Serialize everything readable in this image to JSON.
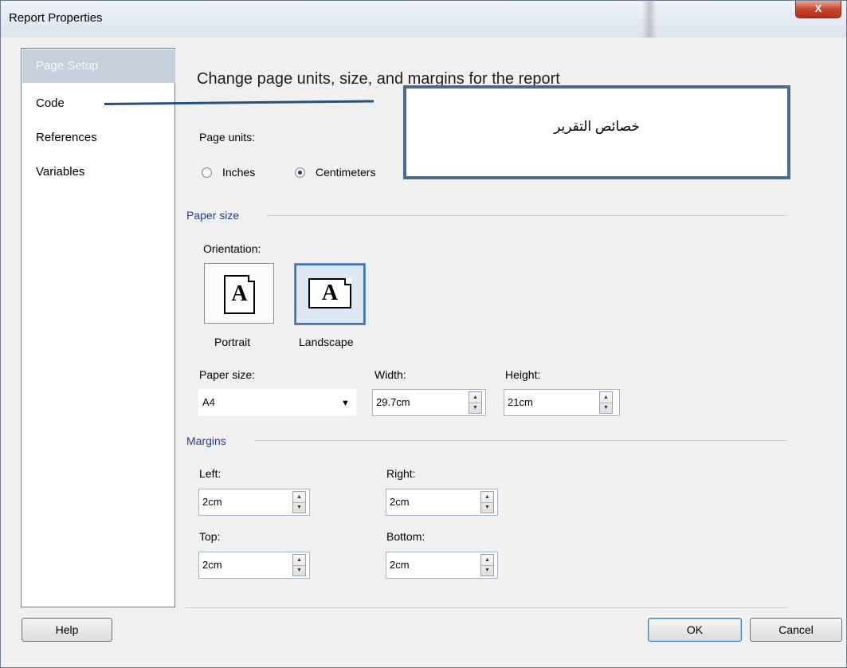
{
  "window": {
    "title": "Report Properties",
    "close_glyph": "X"
  },
  "nav": {
    "items": [
      {
        "label": "Page Setup",
        "active": true
      },
      {
        "label": "Code"
      },
      {
        "label": "References"
      },
      {
        "label": "Variables"
      }
    ]
  },
  "content": {
    "title": "Change page units, size, and margins for the report",
    "page_units_label": "Page units:",
    "units": {
      "inches": "Inches",
      "centimeters": "Centimeters",
      "selected": "Centimeters"
    },
    "paper_section": "Paper size",
    "orientation_label": "Orientation:",
    "orientation": {
      "portrait": "Portrait",
      "landscape": "Landscape",
      "selected": "Landscape",
      "icon_letter": "A"
    },
    "paper_size_label": "Paper size:",
    "paper_size_value": "A4",
    "width_label": "Width:",
    "width_value": "29.7cm",
    "height_label": "Height:",
    "height_value": "21cm",
    "margins_section": "Margins",
    "margins": {
      "left_label": "Left:",
      "left_value": "2cm",
      "right_label": "Right:",
      "right_value": "2cm",
      "top_label": "Top:",
      "top_value": "2cm",
      "bottom_label": "Bottom:",
      "bottom_value": "2cm"
    }
  },
  "annotation": {
    "text": "خصائص التقرير"
  },
  "buttons": {
    "help": "Help",
    "ok": "OK",
    "cancel": "Cancel"
  },
  "colors": {
    "section_heading": "#1f3f8f",
    "nav_active": "#c5d0dc",
    "annotation_border": "#4a6b8e",
    "close_button": "#c7462f"
  },
  "icons": {
    "spin_up": "▲",
    "spin_down": "▼",
    "dropdown": "▼"
  }
}
